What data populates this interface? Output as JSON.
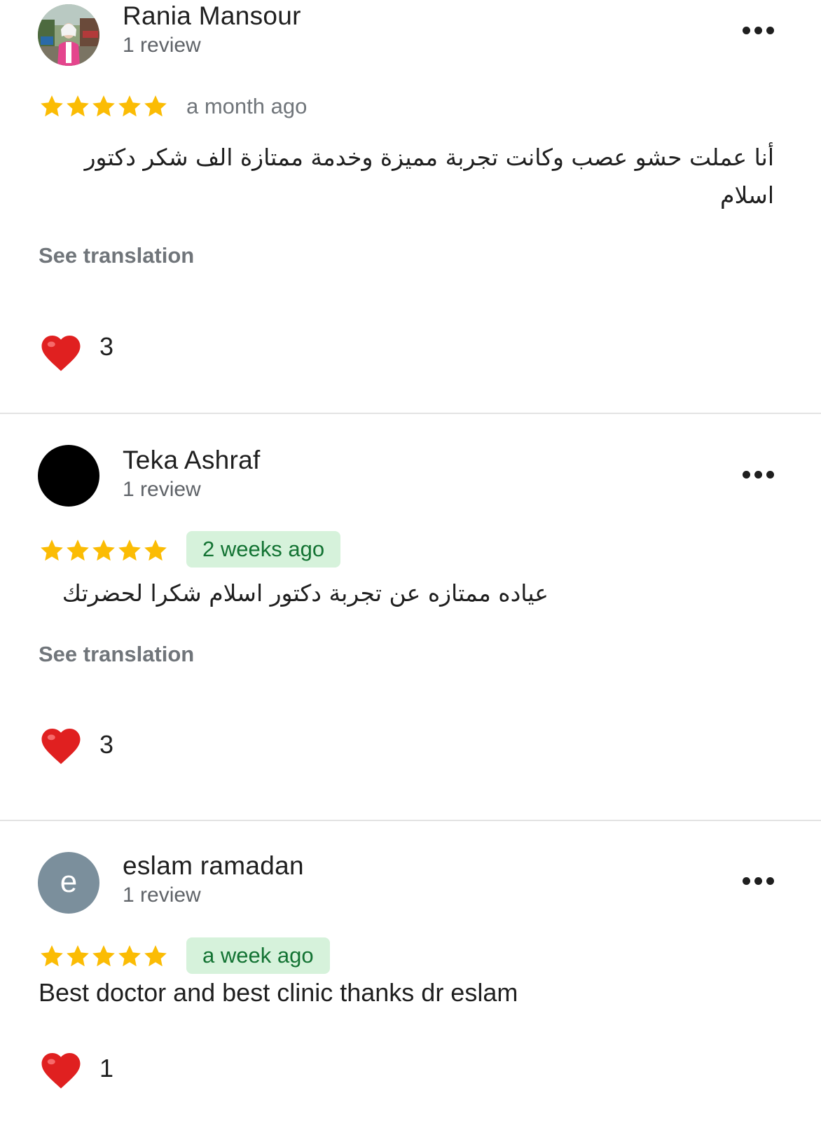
{
  "reviews": [
    {
      "name": "Rania Mansour",
      "review_count": "1 review",
      "avatar": "profile-photo",
      "rating": 5,
      "date": "a month ago",
      "text": "أنا عملت حشو عصب وكانت تجربة مميزة وخدمة ممتازة الف شكر دكتور اسلام",
      "see_translation": "See translation",
      "likes": "3"
    },
    {
      "name": "Teka Ashraf",
      "review_count": "1 review",
      "avatar": "black-circle",
      "rating": 5,
      "date": "2 weeks ago",
      "text": "عياده ممتازه عن تجربة دكتور اسلام شكرا لحضرتك",
      "see_translation": "See translation",
      "likes": "3"
    },
    {
      "name": "eslam ramadan",
      "review_count": "1 review",
      "avatar_letter": "e",
      "rating": 5,
      "date": "a week ago",
      "text": "Best doctor and best clinic thanks dr eslam",
      "likes": "1"
    }
  ],
  "icons": {
    "star": "star-icon",
    "heart": "heart-icon",
    "more": "more-options-icon"
  },
  "colors": {
    "star": "#fbbc04",
    "badge_bg": "#d6f2db",
    "badge_text": "#137333",
    "heart": "#e02020",
    "avatar_letter_bg": "#7b8f9c"
  }
}
